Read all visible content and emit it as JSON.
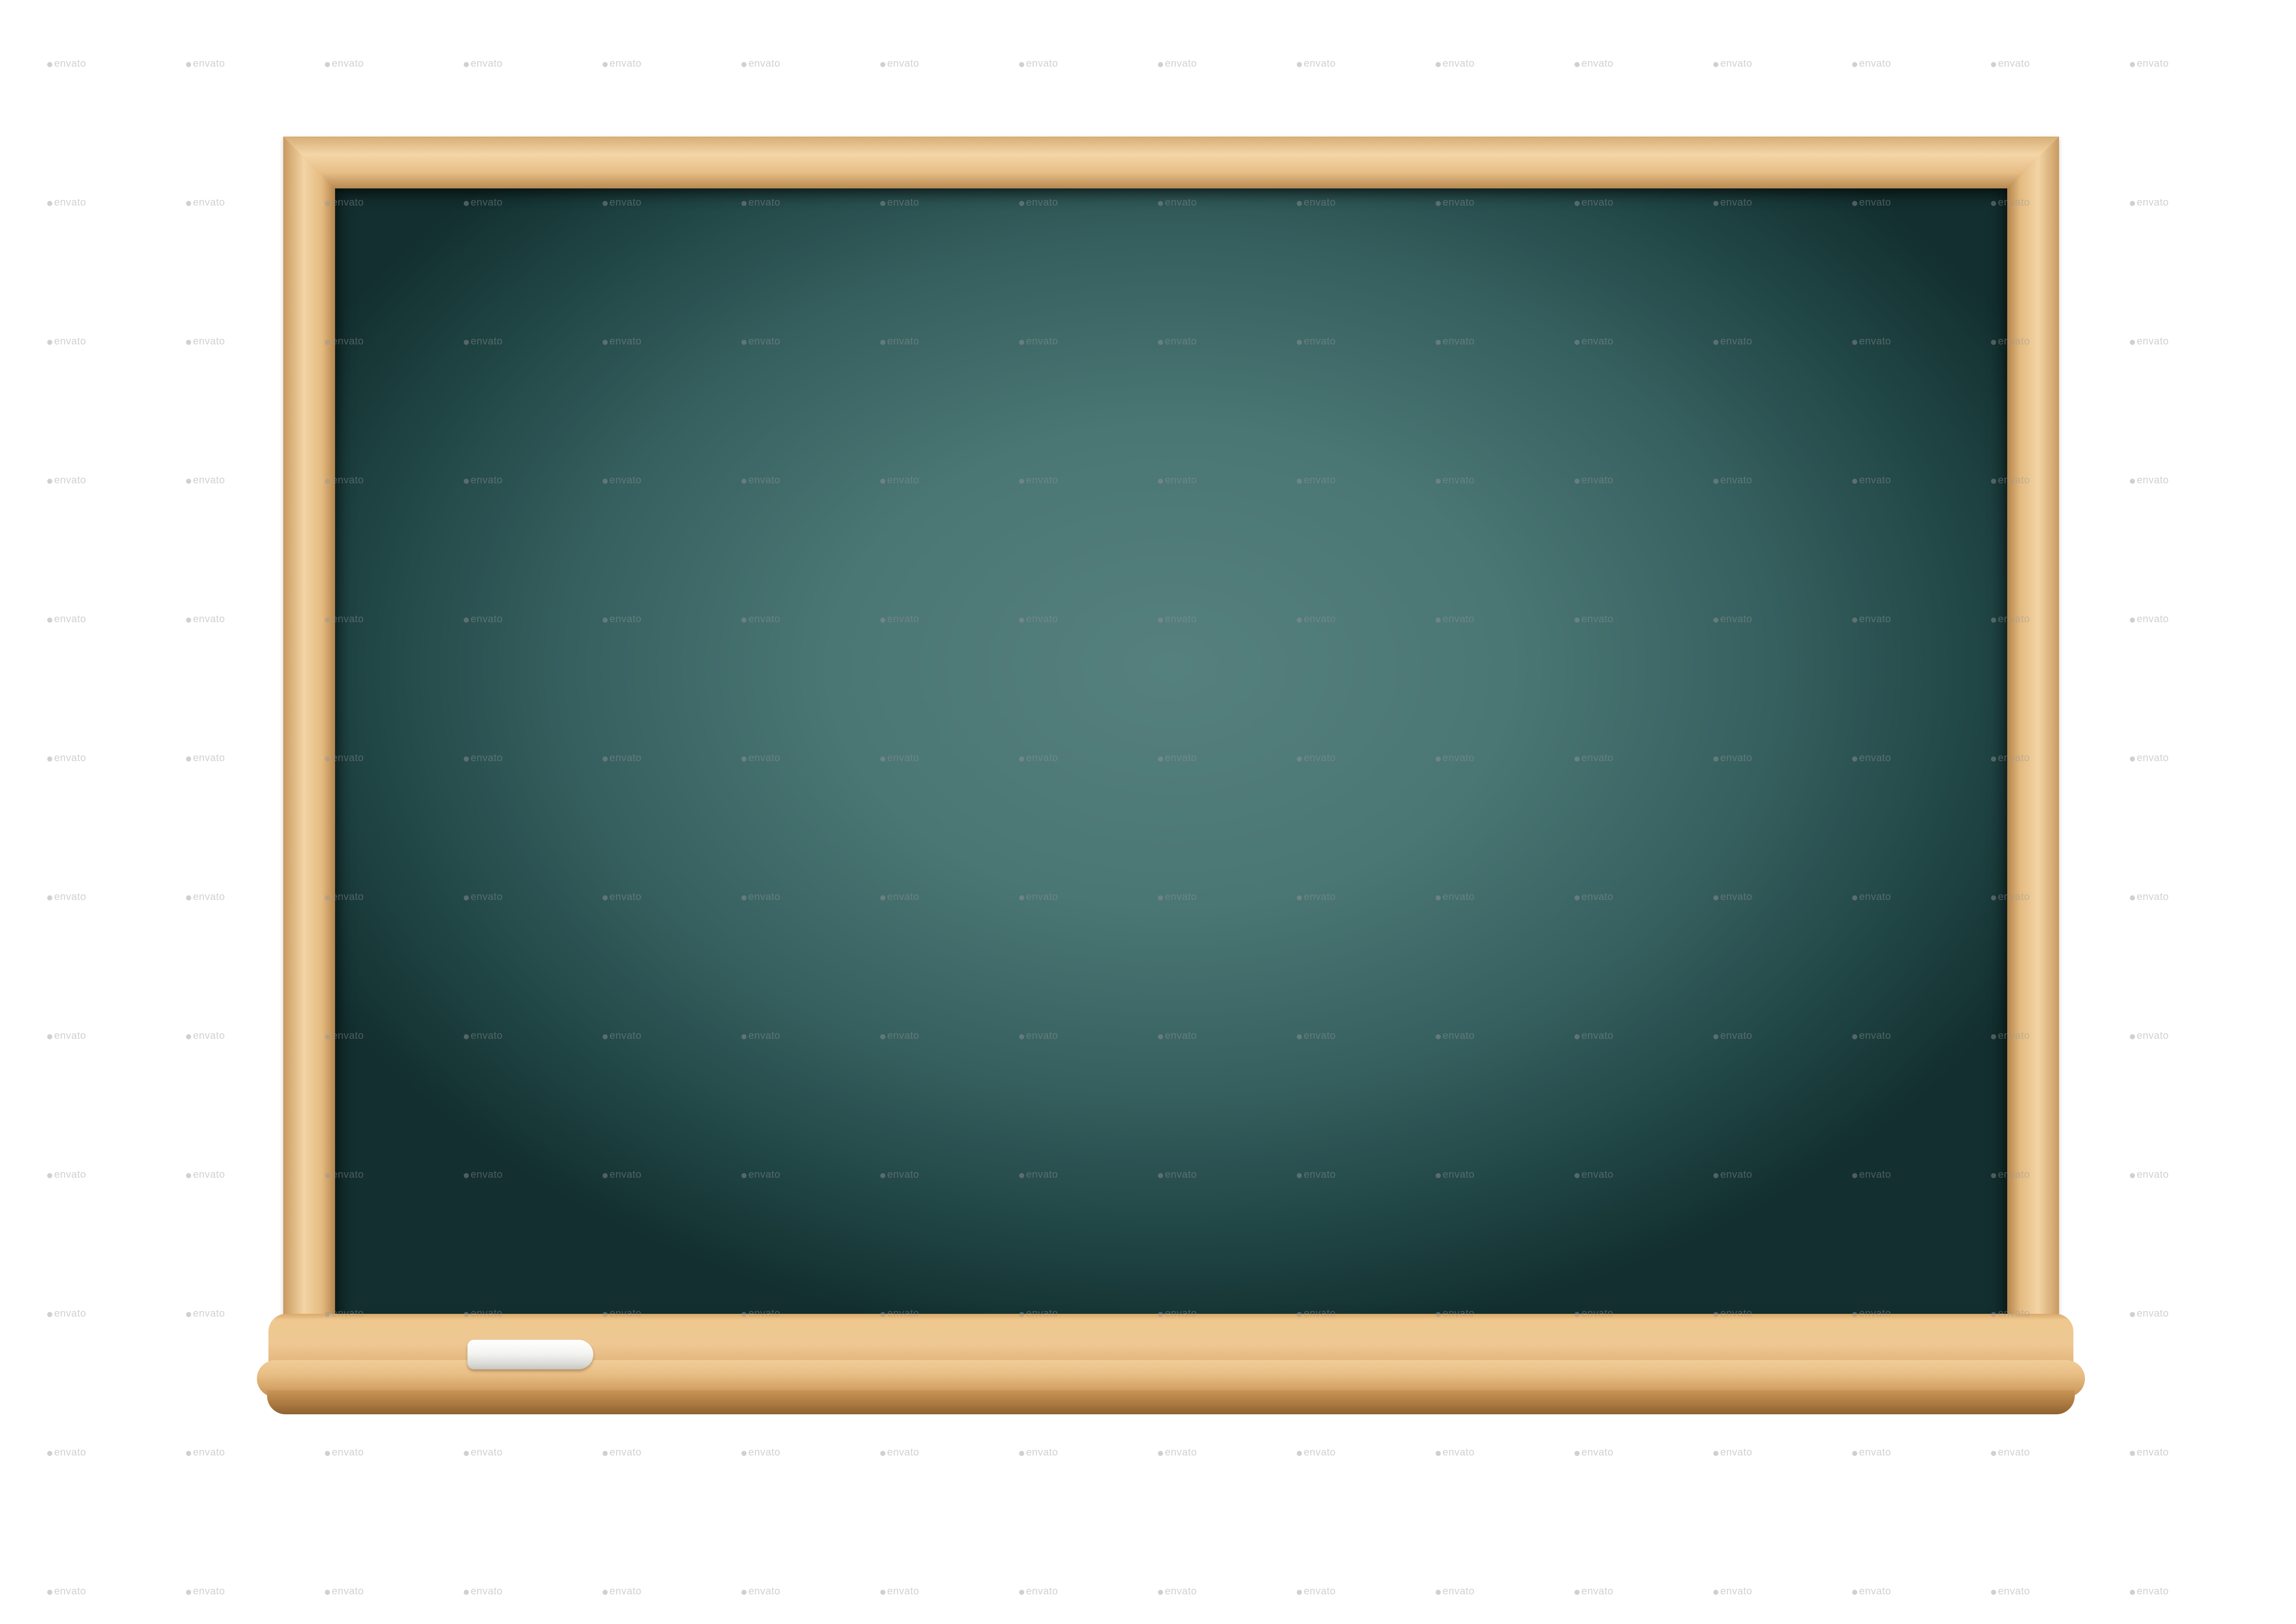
{
  "scene": {
    "subject": "blank chalkboard with wooden frame and chalk",
    "colors": {
      "background": "#ffffff",
      "board_center": "#55807e",
      "board_edge": "#132f2f",
      "wood_light": "#f2d2a3",
      "wood_dark": "#b3854c",
      "chalk": "#f4f4f2"
    }
  },
  "watermark": {
    "text": "envato",
    "color": "#969696"
  }
}
